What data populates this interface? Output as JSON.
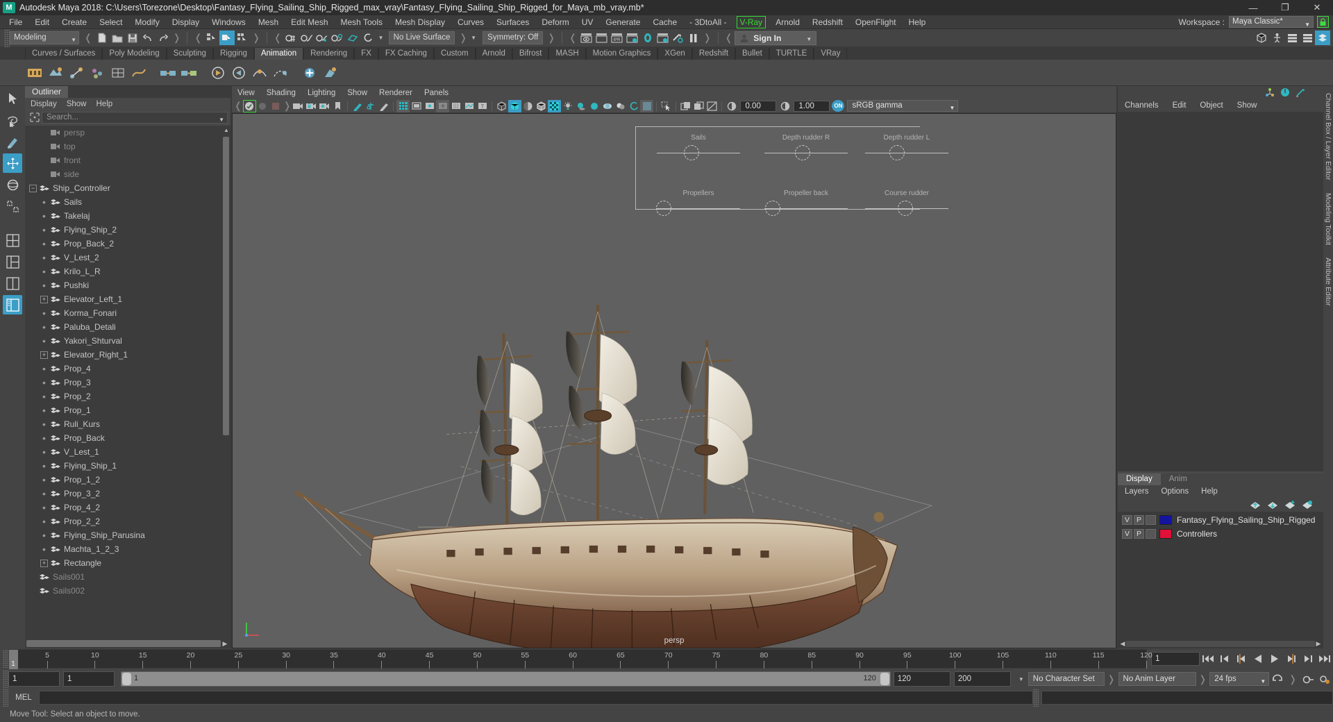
{
  "window": {
    "title": "Autodesk Maya 2018: C:\\Users\\Torezone\\Desktop\\Fantasy_Flying_Sailing_Ship_Rigged_max_vray\\Fantasy_Flying_Sailing_Ship_Rigged_for_Maya_mb_vray.mb*",
    "logo": "M",
    "minimize": "—",
    "maximize": "❐",
    "close": "✕"
  },
  "menubar": {
    "items": [
      "File",
      "Edit",
      "Create",
      "Select",
      "Modify",
      "Display",
      "Windows",
      "Mesh",
      "Edit Mesh",
      "Mesh Tools",
      "Mesh Display",
      "Curves",
      "Surfaces",
      "Deform",
      "UV",
      "Generate",
      "Cache",
      "- 3DtoAll -"
    ],
    "highlighted": "V-Ray",
    "items_after": [
      "Arnold",
      "Redshift",
      "OpenFlight",
      "Help"
    ],
    "workspace_label": "Workspace :",
    "workspace_value": "Maya Classic*",
    "lock_icon": "lock-icon"
  },
  "statusline": {
    "menu_set": "Modeling",
    "live_surface": "No Live Surface",
    "symmetry": "Symmetry: Off",
    "sign_in": "Sign In"
  },
  "shelf": {
    "tabs": [
      "Curves / Surfaces",
      "Poly Modeling",
      "Sculpting",
      "Rigging",
      "Animation",
      "Rendering",
      "FX",
      "FX Caching",
      "Custom",
      "Arnold",
      "Bifrost",
      "MASH",
      "Motion Graphics",
      "XGen",
      "Redshift",
      "Bullet",
      "TURTLE",
      "VRay"
    ],
    "active_tab": "Animation"
  },
  "outliner": {
    "tab": "Outliner",
    "menus": [
      "Display",
      "Show",
      "Help"
    ],
    "search_placeholder": "Search...",
    "items": [
      {
        "label": "persp",
        "type": "camera",
        "indent": 1,
        "dim": true
      },
      {
        "label": "top",
        "type": "camera",
        "indent": 1,
        "dim": true
      },
      {
        "label": "front",
        "type": "camera",
        "indent": 1,
        "dim": true
      },
      {
        "label": "side",
        "type": "camera",
        "indent": 1,
        "dim": true
      },
      {
        "label": "Ship_Controller",
        "type": "transform",
        "indent": 0,
        "expand": "minus"
      },
      {
        "label": "Sails",
        "type": "transform",
        "indent": 1,
        "expand": "dot"
      },
      {
        "label": "Takelaj",
        "type": "transform",
        "indent": 1,
        "expand": "dot"
      },
      {
        "label": "Flying_Ship_2",
        "type": "transform",
        "indent": 1,
        "expand": "dot"
      },
      {
        "label": "Prop_Back_2",
        "type": "transform",
        "indent": 1,
        "expand": "dot"
      },
      {
        "label": "V_Lest_2",
        "type": "transform",
        "indent": 1,
        "expand": "dot"
      },
      {
        "label": "Krilo_L_R",
        "type": "transform",
        "indent": 1,
        "expand": "dot"
      },
      {
        "label": "Pushki",
        "type": "transform",
        "indent": 1,
        "expand": "dot"
      },
      {
        "label": "Elevator_Left_1",
        "type": "transform",
        "indent": 1,
        "expand": "plus"
      },
      {
        "label": "Korma_Fonari",
        "type": "transform",
        "indent": 1,
        "expand": "dot"
      },
      {
        "label": "Paluba_Detali",
        "type": "transform",
        "indent": 1,
        "expand": "dot"
      },
      {
        "label": "Yakori_Shturval",
        "type": "transform",
        "indent": 1,
        "expand": "dot"
      },
      {
        "label": "Elevator_Right_1",
        "type": "transform",
        "indent": 1,
        "expand": "plus"
      },
      {
        "label": "Prop_4",
        "type": "transform",
        "indent": 1,
        "expand": "dot"
      },
      {
        "label": "Prop_3",
        "type": "transform",
        "indent": 1,
        "expand": "dot"
      },
      {
        "label": "Prop_2",
        "type": "transform",
        "indent": 1,
        "expand": "dot"
      },
      {
        "label": "Prop_1",
        "type": "transform",
        "indent": 1,
        "expand": "dot"
      },
      {
        "label": "Ruli_Kurs",
        "type": "transform",
        "indent": 1,
        "expand": "dot"
      },
      {
        "label": "Prop_Back",
        "type": "transform",
        "indent": 1,
        "expand": "dot"
      },
      {
        "label": "V_Lest_1",
        "type": "transform",
        "indent": 1,
        "expand": "dot"
      },
      {
        "label": "Flying_Ship_1",
        "type": "transform",
        "indent": 1,
        "expand": "dot"
      },
      {
        "label": "Prop_1_2",
        "type": "transform",
        "indent": 1,
        "expand": "dot"
      },
      {
        "label": "Prop_3_2",
        "type": "transform",
        "indent": 1,
        "expand": "dot"
      },
      {
        "label": "Prop_4_2",
        "type": "transform",
        "indent": 1,
        "expand": "dot"
      },
      {
        "label": "Prop_2_2",
        "type": "transform",
        "indent": 1,
        "expand": "dot"
      },
      {
        "label": "Flying_Ship_Parusina",
        "type": "transform",
        "indent": 1,
        "expand": "dot"
      },
      {
        "label": "Machta_1_2_3",
        "type": "transform",
        "indent": 1,
        "expand": "dot"
      },
      {
        "label": "Rectangle",
        "type": "transform",
        "indent": 1,
        "expand": "plus",
        "last": true
      },
      {
        "label": "Sails001",
        "type": "transform",
        "indent": 0,
        "dim": true
      },
      {
        "label": "Sails002",
        "type": "transform",
        "indent": 0,
        "dim": true
      }
    ]
  },
  "viewport": {
    "menus": [
      "View",
      "Shading",
      "Lighting",
      "Show",
      "Renderer",
      "Panels"
    ],
    "exposure": "0.00",
    "gamma": "1.00",
    "gamma_toggle": "ON",
    "color_space": "sRGB gamma",
    "camera_label": "persp",
    "hud_controls": [
      {
        "label": "Sails",
        "knob": 0.42
      },
      {
        "label": "Depth rudder R",
        "knob": 0.46
      },
      {
        "label": "Depth rudder L",
        "knob": 0.38
      },
      {
        "label": "Propellers",
        "knob": 0.08
      },
      {
        "label": "Propeller back",
        "knob": 0.1
      },
      {
        "label": "Course rudder",
        "knob": 0.48
      }
    ]
  },
  "channelbox": {
    "menus": [
      "Channels",
      "Edit",
      "Object",
      "Show"
    ],
    "side_tabs": [
      "Channel Box / Layer Editor",
      "Modeling Toolkit",
      "Attribute Editor"
    ]
  },
  "layer_editor": {
    "tabs": [
      "Display",
      "Anim"
    ],
    "active_tab": "Display",
    "menus": [
      "Layers",
      "Options",
      "Help"
    ],
    "layers": [
      {
        "v": "V",
        "p": "P",
        "flag": "",
        "color": "#1414a0",
        "name": "Fantasy_Flying_Sailing_Ship_Rigged"
      },
      {
        "v": "V",
        "p": "P",
        "flag": "",
        "color": "#e01038",
        "name": "Controllers"
      }
    ]
  },
  "timeline": {
    "ticks": [
      5,
      10,
      15,
      20,
      25,
      30,
      35,
      40,
      45,
      50,
      55,
      60,
      65,
      70,
      75,
      80,
      85,
      90,
      95,
      100,
      105,
      110,
      115,
      120
    ],
    "start": 1,
    "end": 120,
    "current_frame": "1",
    "current_frame_label": "1"
  },
  "rangeslider": {
    "anim_start": "1",
    "range_start": "1",
    "slider_min_label": "1",
    "slider_max_label": "120",
    "range_end": "120",
    "anim_end": "200",
    "character_set": "No Character Set",
    "anim_layer": "No Anim Layer",
    "fps": "24 fps"
  },
  "command_line": {
    "label": "MEL",
    "value": ""
  },
  "status": {
    "help_text": "Move Tool: Select an object to move."
  }
}
